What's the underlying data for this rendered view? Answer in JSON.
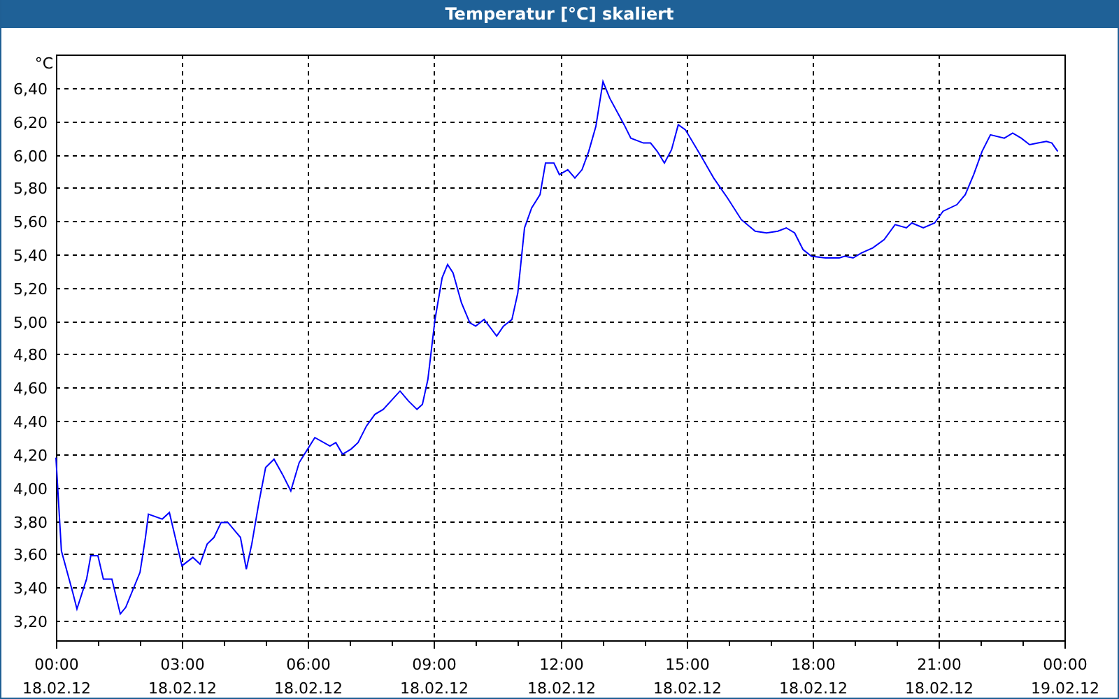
{
  "window": {
    "title": "Temperatur [°C] skaliert"
  },
  "chart": {
    "chart_data": {
      "type": "line",
      "grid": true,
      "ylabel": "°C",
      "x": [
        0,
        0.13,
        0.4,
        0.5,
        0.73,
        0.83,
        1,
        1.13,
        1.33,
        1.53,
        1.66,
        2,
        2.13,
        2.2,
        2.53,
        2.7,
        3,
        3.26,
        3.43,
        3.6,
        3.76,
        3.93,
        4.09,
        4.39,
        4.53,
        4.66,
        4.83,
        4.99,
        5.19,
        5.39,
        5.59,
        5.79,
        5.99,
        6.16,
        6.52,
        6.66,
        6.82,
        7.02,
        7.19,
        7.39,
        7.59,
        7.79,
        8.19,
        8.39,
        8.59,
        8.72,
        8.85,
        9.02,
        9.19,
        9.32,
        9.45,
        9.65,
        9.85,
        9.99,
        10.19,
        10.49,
        10.65,
        10.85,
        10.99,
        11.15,
        11.32,
        11.52,
        11.65,
        11.85,
        11.98,
        12.18,
        12.35,
        12.52,
        12.68,
        12.85,
        13.02,
        13.18,
        13.52,
        13.68,
        13.98,
        14.15,
        14.31,
        14.48,
        14.65,
        14.81,
        14.98,
        15.38,
        15.65,
        15.98,
        16.31,
        16.64,
        16.91,
        17.18,
        17.38,
        17.58,
        17.78,
        17.98,
        18.31,
        18.64,
        18.77,
        18.97,
        19.17,
        19.44,
        19.71,
        19.97,
        20.24,
        20.37,
        20.64,
        20.91,
        21.11,
        21.44,
        21.64,
        21.84,
        22.04,
        22.24,
        22.57,
        22.77,
        22.97,
        23.17,
        23.37,
        23.57,
        23.7,
        23.84
      ],
      "series": [
        {
          "color": "#0000ff",
          "values": [
            4.18,
            3.62,
            3.37,
            3.27,
            3.45,
            3.59,
            3.59,
            3.45,
            3.45,
            3.24,
            3.28,
            3.49,
            3.7,
            3.84,
            3.81,
            3.85,
            3.53,
            3.58,
            3.54,
            3.66,
            3.7,
            3.79,
            3.79,
            3.7,
            3.51,
            3.66,
            3.91,
            4.12,
            4.17,
            4.08,
            3.98,
            4.15,
            4.23,
            4.3,
            4.25,
            4.27,
            4.2,
            4.23,
            4.27,
            4.37,
            4.44,
            4.47,
            4.58,
            4.52,
            4.47,
            4.5,
            4.65,
            5.01,
            5.26,
            5.34,
            5.29,
            5.11,
            4.99,
            4.97,
            5.01,
            4.91,
            4.97,
            5.01,
            5.17,
            5.56,
            5.68,
            5.76,
            5.95,
            5.95,
            5.88,
            5.91,
            5.86,
            5.91,
            6.02,
            6.17,
            6.44,
            6.34,
            6.18,
            6.1,
            6.07,
            6.07,
            6.02,
            5.95,
            6.03,
            6.18,
            6.15,
            5.98,
            5.86,
            5.74,
            5.61,
            5.54,
            5.53,
            5.54,
            5.56,
            5.53,
            5.43,
            5.39,
            5.38,
            5.38,
            5.39,
            5.38,
            5.41,
            5.44,
            5.49,
            5.58,
            5.56,
            5.59,
            5.56,
            5.59,
            5.66,
            5.7,
            5.76,
            5.88,
            6.02,
            6.12,
            6.1,
            6.13,
            6.1,
            6.06,
            6.07,
            6.08,
            6.07,
            6.02
          ]
        }
      ],
      "xlim": [
        0,
        24
      ],
      "ylim": [
        3.082,
        6.602
      ],
      "xticks": [
        {
          "value": 0,
          "label": "00:00"
        },
        {
          "value": 3,
          "label": "03:00"
        },
        {
          "value": 6,
          "label": "06:00"
        },
        {
          "value": 9,
          "label": "09:00"
        },
        {
          "value": 12,
          "label": "12:00"
        },
        {
          "value": 15,
          "label": "15:00"
        },
        {
          "value": 18,
          "label": "18:00"
        },
        {
          "value": 21,
          "label": "21:00"
        },
        {
          "value": 24,
          "label": "00:00"
        }
      ],
      "yticks": [
        {
          "value": 3.2,
          "label": "3,20"
        },
        {
          "value": 3.4,
          "label": "3,40"
        },
        {
          "value": 3.6,
          "label": "3,60"
        },
        {
          "value": 3.8,
          "label": "3,80"
        },
        {
          "value": 4,
          "label": "4,00"
        },
        {
          "value": 4.2,
          "label": "4,20"
        },
        {
          "value": 4.4,
          "label": "4,40"
        },
        {
          "value": 4.6,
          "label": "4,60"
        },
        {
          "value": 4.8,
          "label": "4,80"
        },
        {
          "value": 5,
          "label": "5,00"
        },
        {
          "value": 5.2,
          "label": "5,20"
        },
        {
          "value": 5.4,
          "label": "5,40"
        },
        {
          "value": 5.6,
          "label": "5,60"
        },
        {
          "value": 5.8,
          "label": "5,80"
        },
        {
          "value": 6,
          "label": "6,00"
        },
        {
          "value": 6.2,
          "label": "6,20"
        },
        {
          "value": 6.4,
          "label": "6,40"
        }
      ]
    },
    "xtick_dates": [
      "18.02.12",
      "18.02.12",
      "18.02.12",
      "18.02.12",
      "18.02.12",
      "18.02.12",
      "18.02.12",
      "18.02.12",
      "19.02.12"
    ]
  }
}
